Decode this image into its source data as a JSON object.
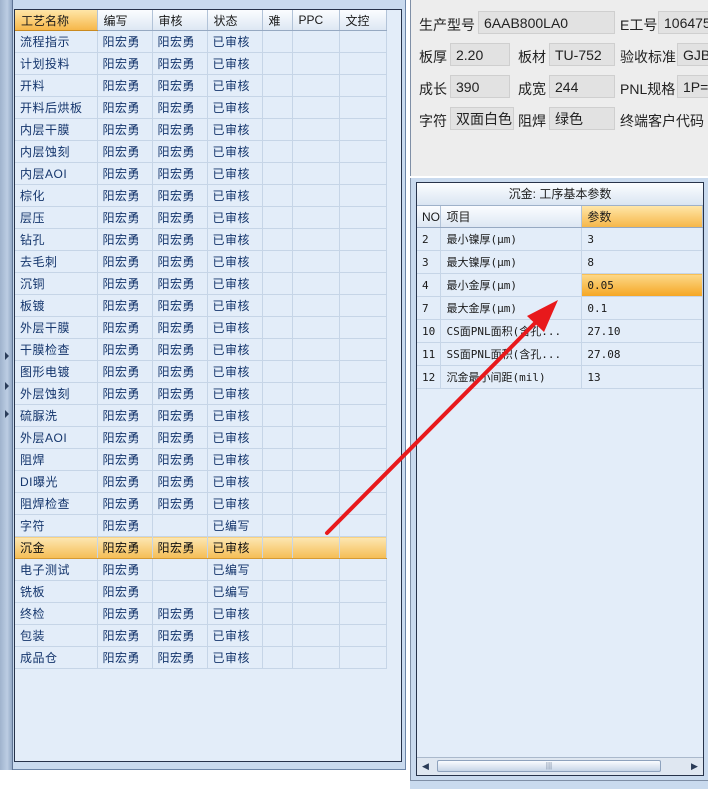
{
  "process_grid": {
    "columns": [
      "工艺名称",
      "编写",
      "审核",
      "状态",
      "难",
      "PPC",
      "文控"
    ],
    "rows": [
      {
        "name": "流程指示",
        "writer": "阳宏勇",
        "reviewer": "阳宏勇",
        "status": "已审核"
      },
      {
        "name": "计划投料",
        "writer": "阳宏勇",
        "reviewer": "阳宏勇",
        "status": "已审核"
      },
      {
        "name": "开料",
        "writer": "阳宏勇",
        "reviewer": "阳宏勇",
        "status": "已审核"
      },
      {
        "name": "开料后烘板",
        "writer": "阳宏勇",
        "reviewer": "阳宏勇",
        "status": "已审核"
      },
      {
        "name": "内层干膜",
        "writer": "阳宏勇",
        "reviewer": "阳宏勇",
        "status": "已审核"
      },
      {
        "name": "内层蚀刻",
        "writer": "阳宏勇",
        "reviewer": "阳宏勇",
        "status": "已审核"
      },
      {
        "name": "内层AOI",
        "writer": "阳宏勇",
        "reviewer": "阳宏勇",
        "status": "已审核"
      },
      {
        "name": "棕化",
        "writer": "阳宏勇",
        "reviewer": "阳宏勇",
        "status": "已审核"
      },
      {
        "name": "层压",
        "writer": "阳宏勇",
        "reviewer": "阳宏勇",
        "status": "已审核"
      },
      {
        "name": "钻孔",
        "writer": "阳宏勇",
        "reviewer": "阳宏勇",
        "status": "已审核"
      },
      {
        "name": "去毛刺",
        "writer": "阳宏勇",
        "reviewer": "阳宏勇",
        "status": "已审核"
      },
      {
        "name": "沉铜",
        "writer": "阳宏勇",
        "reviewer": "阳宏勇",
        "status": "已审核"
      },
      {
        "name": "板镀",
        "writer": "阳宏勇",
        "reviewer": "阳宏勇",
        "status": "已审核"
      },
      {
        "name": "外层干膜",
        "writer": "阳宏勇",
        "reviewer": "阳宏勇",
        "status": "已审核"
      },
      {
        "name": "干膜检查",
        "writer": "阳宏勇",
        "reviewer": "阳宏勇",
        "status": "已审核"
      },
      {
        "name": "图形电镀",
        "writer": "阳宏勇",
        "reviewer": "阳宏勇",
        "status": "已审核"
      },
      {
        "name": "外层蚀刻",
        "writer": "阳宏勇",
        "reviewer": "阳宏勇",
        "status": "已审核"
      },
      {
        "name": "硫脲洗",
        "writer": "阳宏勇",
        "reviewer": "阳宏勇",
        "status": "已审核"
      },
      {
        "name": "外层AOI",
        "writer": "阳宏勇",
        "reviewer": "阳宏勇",
        "status": "已审核"
      },
      {
        "name": "阻焊",
        "writer": "阳宏勇",
        "reviewer": "阳宏勇",
        "status": "已审核"
      },
      {
        "name": "DI曝光",
        "writer": "阳宏勇",
        "reviewer": "阳宏勇",
        "status": "已审核"
      },
      {
        "name": "阻焊检查",
        "writer": "阳宏勇",
        "reviewer": "阳宏勇",
        "status": "已审核"
      },
      {
        "name": "字符",
        "writer": "阳宏勇",
        "reviewer": "",
        "status": "已编写"
      },
      {
        "name": "沉金",
        "writer": "阳宏勇",
        "reviewer": "阳宏勇",
        "status": "已审核",
        "selected": true
      },
      {
        "name": "电子测试",
        "writer": "阳宏勇",
        "reviewer": "",
        "status": "已编写"
      },
      {
        "name": "铣板",
        "writer": "阳宏勇",
        "reviewer": "",
        "status": "已编写"
      },
      {
        "name": "终检",
        "writer": "阳宏勇",
        "reviewer": "阳宏勇",
        "status": "已审核"
      },
      {
        "name": "包装",
        "writer": "阳宏勇",
        "reviewer": "阳宏勇",
        "status": "已审核"
      },
      {
        "name": "成品仓",
        "writer": "阳宏勇",
        "reviewer": "阳宏勇",
        "status": "已审核"
      }
    ]
  },
  "info_panel": {
    "product_model_label": "生产型号",
    "product_model": "6AAB800LA0",
    "eng_no_label": "E工号",
    "eng_no": "106475",
    "thickness_label": "板厚",
    "thickness": "2.20",
    "material_label": "板材",
    "material": "TU-752",
    "acceptance_label": "验收标准",
    "acceptance": "GJB",
    "length_label": "成长",
    "length": "390",
    "width_label": "成宽",
    "width": "244",
    "pnl_label": "PNL规格",
    "pnl": "1P=",
    "legend_label": "字符",
    "legend": "双面白色",
    "soldermask_label": "阻焊",
    "soldermask": "绿色",
    "end_customer_label": "终端客户代码"
  },
  "params_panel": {
    "title": "沉金: 工序基本参数",
    "columns": [
      "NO",
      "项目",
      "参数"
    ],
    "rows": [
      {
        "no": "2",
        "item": "最小镍厚(μm)",
        "value": "3"
      },
      {
        "no": "3",
        "item": "最大镍厚(μm)",
        "value": "8"
      },
      {
        "no": "4",
        "item": "最小金厚(μm)",
        "value": "0.05",
        "highlight": true
      },
      {
        "no": "7",
        "item": "最大金厚(μm)",
        "value": "0.1"
      },
      {
        "no": "10",
        "item": "CS面PNL面积(含孔...",
        "value": "27.10"
      },
      {
        "no": "11",
        "item": "SS面PNL面积(含孔...",
        "value": "27.08"
      },
      {
        "no": "12",
        "item": "沉金最小间距(mil)",
        "value": "13"
      }
    ]
  },
  "annotation": {
    "arrow_color": "#e8191c"
  },
  "icons": {
    "scroll_left": "◀",
    "scroll_right": "▶",
    "scroll_grip": "|||"
  }
}
